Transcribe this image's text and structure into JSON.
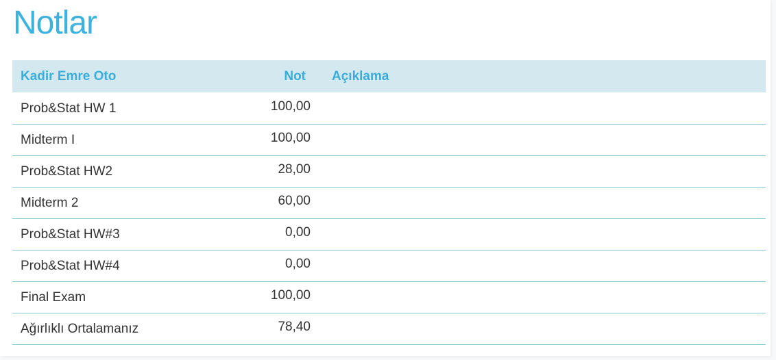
{
  "colors": {
    "title": "#3db2dc",
    "header_text": "#3aaed9",
    "header_bg": "#d4e9ef",
    "row_border": "#7fcbd8",
    "body_text": "#333333"
  },
  "page": {
    "title": "Notlar"
  },
  "table": {
    "headers": {
      "name": "Kadir Emre Oto",
      "grade": "Not",
      "description": "Açıklama"
    },
    "rows": [
      {
        "name": "Prob&Stat HW 1",
        "grade": "100,00",
        "description": ""
      },
      {
        "name": "Midterm I",
        "grade": "100,00",
        "description": ""
      },
      {
        "name": "Prob&Stat HW2",
        "grade": "28,00",
        "description": ""
      },
      {
        "name": "Midterm 2",
        "grade": "60,00",
        "description": ""
      },
      {
        "name": "Prob&Stat HW#3",
        "grade": "0,00",
        "description": ""
      },
      {
        "name": "Prob&Stat HW#4",
        "grade": "0,00",
        "description": ""
      },
      {
        "name": "Final Exam",
        "grade": "100,00",
        "description": ""
      },
      {
        "name": "Ağırlıklı Ortalamanız",
        "grade": "78,40",
        "description": ""
      }
    ]
  }
}
